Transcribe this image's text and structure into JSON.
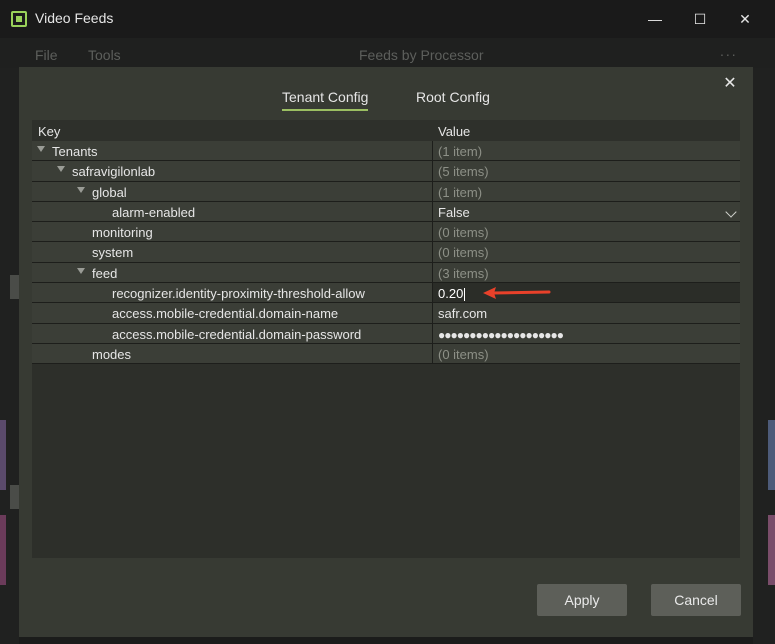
{
  "window": {
    "title": "Video Feeds",
    "controls": {
      "minimize": "—",
      "maximize": "☐",
      "close": "✕"
    }
  },
  "menubar": {
    "items": [
      "File",
      "Tools"
    ],
    "center_tab": "Feeds by Processor",
    "overflow": "..."
  },
  "dialog": {
    "close": "✕",
    "tabs": [
      {
        "label": "Tenant Config",
        "active": true
      },
      {
        "label": "Root Config",
        "active": false
      }
    ],
    "grid": {
      "headers": {
        "key": "Key",
        "value": "Value"
      },
      "rows": [
        {
          "key": "Tenants",
          "value": "(1 item)",
          "level": 0,
          "expandable": true
        },
        {
          "key": "safravigilonlab",
          "value": "(5 items)",
          "level": 1,
          "expandable": true
        },
        {
          "key": "global",
          "value": "(1 item)",
          "level": 2,
          "expandable": true
        },
        {
          "key": "alarm-enabled",
          "value": "False",
          "level": 3,
          "expandable": false
        },
        {
          "key": "monitoring",
          "value": "(0 items)",
          "level": 2,
          "expandable": false
        },
        {
          "key": "system",
          "value": "(0 items)",
          "level": 2,
          "expandable": false
        },
        {
          "key": "feed",
          "value": "(3 items)",
          "level": 2,
          "expandable": true
        },
        {
          "key": "recognizer.identity-proximity-threshold-allow",
          "value": "0.20",
          "level": 3,
          "expandable": false
        },
        {
          "key": "access.mobile-credential.domain-name",
          "value": "safr.com",
          "level": 3,
          "expandable": false
        },
        {
          "key": "access.mobile-credential.domain-password",
          "value": "●●●●●●●●●●●●●●●●●●●●",
          "level": 3,
          "expandable": false
        },
        {
          "key": "modes",
          "value": "(0 items)",
          "level": 2,
          "expandable": false
        }
      ]
    },
    "buttons": {
      "apply": "Apply",
      "cancel": "Cancel"
    }
  },
  "colors": {
    "accent": "#9bbf62",
    "annotation_arrow": "#e8412a",
    "dialog_bg": "#373a33",
    "row_bg": "#3b3e37"
  }
}
